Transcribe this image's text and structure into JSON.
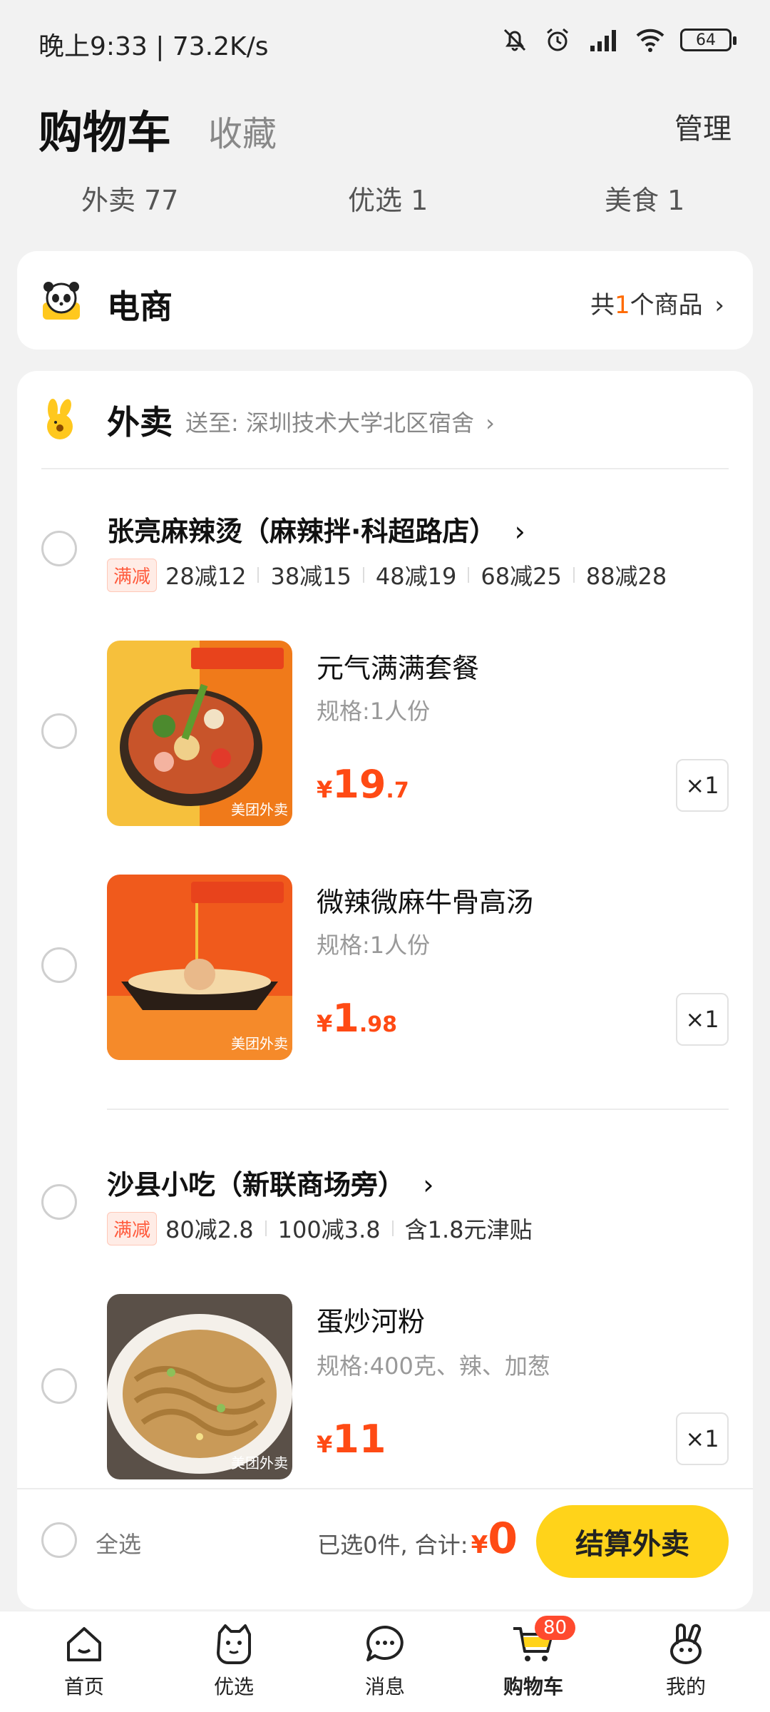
{
  "status_bar": {
    "time": "晚上9:33 | 73.2K/s",
    "battery": "64"
  },
  "header": {
    "title": "购物车",
    "favorites": "收藏",
    "manage": "管理"
  },
  "tabs": [
    {
      "label": "外卖 77"
    },
    {
      "label": "优选 1"
    },
    {
      "label": "美食 1"
    }
  ],
  "ecommerce": {
    "label": "电商",
    "count_prefix": "共",
    "count": "1",
    "count_suffix": "个商品",
    "chevron": "›"
  },
  "waimai": {
    "label": "外卖",
    "deliver_to": "送至: 深圳技术大学北区宿舍",
    "chevron": "›"
  },
  "shops": [
    {
      "name": "张亮麻辣烫（麻辣拌·科超路店）",
      "chevron": "›",
      "promo_tag": "满减",
      "promos": [
        "28减12",
        "38减15",
        "48减19",
        "68减25",
        "88减28"
      ],
      "items": [
        {
          "name": "元气满满套餐",
          "spec": "规格:1人份",
          "price_sym": "¥",
          "price_int": "19",
          "price_dec": ".7",
          "qty": "×1",
          "thumb_watermark": "美团外卖"
        },
        {
          "name": "微辣微麻牛骨高汤",
          "spec": "规格:1人份",
          "price_sym": "¥",
          "price_int": "1",
          "price_dec": ".98",
          "qty": "×1",
          "thumb_watermark": "美团外卖"
        }
      ]
    },
    {
      "name": "沙县小吃（新联商场旁）",
      "chevron": "›",
      "promo_tag": "满减",
      "promos": [
        "80减2.8",
        "100减3.8",
        "含1.8元津贴"
      ],
      "items": [
        {
          "name": "蛋炒河粉",
          "spec": "规格:400克、辣、加葱",
          "price_sym": "¥",
          "price_int": "11",
          "price_dec": "",
          "qty": "×1",
          "thumb_watermark": "美团外卖"
        }
      ]
    }
  ],
  "checkout": {
    "select_all": "全选",
    "selected_text": "已选0件, 合计:",
    "total_sym": "¥",
    "total": "0",
    "button": "结算外卖"
  },
  "nav": [
    {
      "label": "首页",
      "icon": "home-icon"
    },
    {
      "label": "优选",
      "icon": "cat-face-icon"
    },
    {
      "label": "消息",
      "icon": "chat-bubble-icon"
    },
    {
      "label": "购物车",
      "icon": "cart-icon",
      "badge": "80",
      "active": true
    },
    {
      "label": "我的",
      "icon": "rabbit-icon"
    }
  ],
  "colors": {
    "accent_orange": "#ff4a14",
    "checkout_yellow": "#ffd31a",
    "badge_red": "#ff4a2e"
  }
}
